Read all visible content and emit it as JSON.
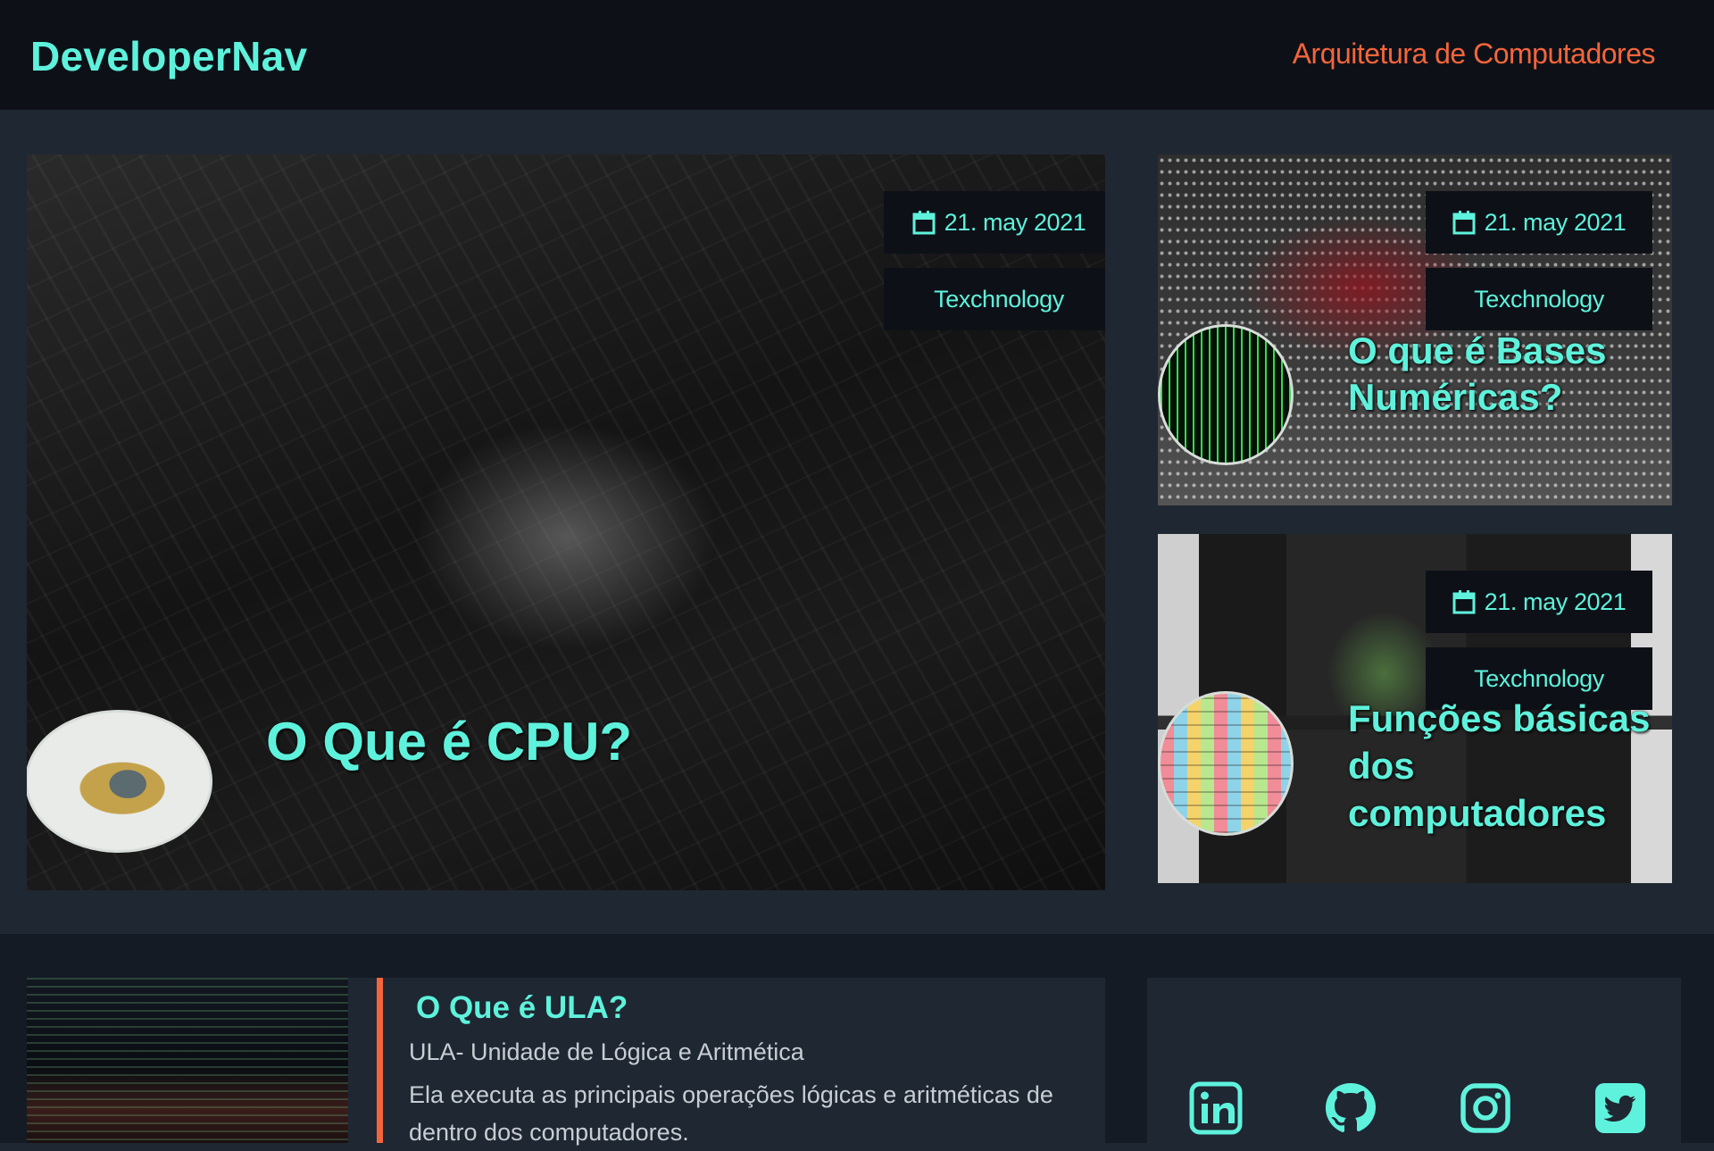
{
  "header": {
    "logo": "DeveloperNav",
    "nav_link": "Arquitetura de Computadores"
  },
  "featured": {
    "date": "21. may 2021",
    "category": "Texchnology",
    "title": "O Que é CPU?"
  },
  "side_cards": [
    {
      "date": "21. may 2021",
      "category": "Texchnology",
      "title": "O que é Bases Numéricas?"
    },
    {
      "date": "21. may 2021",
      "category": "Texchnology",
      "title": "Funções básicas dos computadores"
    }
  ],
  "article": {
    "title": "O Que é ULA?",
    "subtitle": "ULA- Unidade de Lógica e Aritmética",
    "body": "Ela executa as principais operações lógicas e aritméticas de dentro dos computadores."
  },
  "social": {
    "icons": [
      "linkedin-icon",
      "github-icon",
      "instagram-icon",
      "twitter-icon"
    ]
  },
  "colors": {
    "accent": "#5ef2dc",
    "nav": "#f5653b",
    "header_bg": "#0d1117",
    "page_bg": "#1f2732"
  }
}
